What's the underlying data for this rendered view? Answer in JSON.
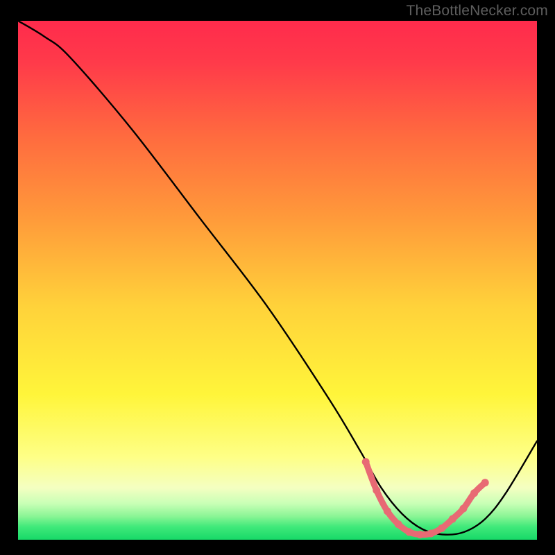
{
  "attribution": "TheBottleNecker.com",
  "colors": {
    "gradient_top": "#ff2b4c",
    "gradient_mid_orange": "#ff8a3a",
    "gradient_yellow": "#fff63a",
    "gradient_pale_yellow": "#fdffa8",
    "gradient_green": "#2fe36f",
    "curve": "#000000",
    "marker": "#e86a74",
    "frame": "#000000"
  },
  "chart_data": {
    "type": "line",
    "title": "",
    "xlabel": "",
    "ylabel": "",
    "xlim": [
      0,
      100
    ],
    "ylim": [
      0,
      100
    ],
    "series": [
      {
        "name": "bottleneck-curve",
        "x": [
          0,
          5,
          10,
          22,
          35,
          48,
          60,
          66,
          70,
          74,
          78,
          82,
          86,
          90,
          94,
          100
        ],
        "y": [
          100,
          97,
          93,
          79,
          62,
          45,
          27,
          17,
          10,
          5,
          2,
          1,
          1.5,
          4,
          9,
          19
        ]
      }
    ],
    "highlight_range": {
      "comment": "salmon pointed segment near the minimum",
      "x": [
        67,
        90
      ],
      "y_at_points": [
        15,
        9.5,
        5.5,
        3,
        1.5,
        1,
        1.2,
        2.2,
        4,
        6,
        9,
        11
      ]
    }
  }
}
